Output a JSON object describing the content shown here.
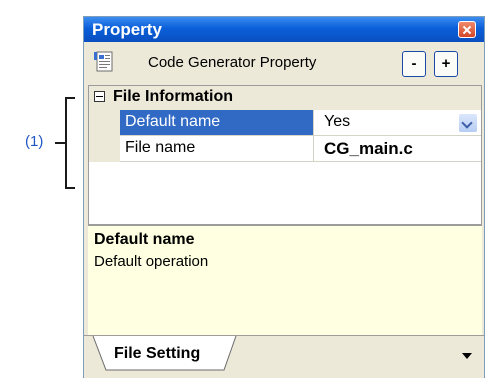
{
  "annotation": {
    "label": "(1)"
  },
  "window": {
    "title": "Property",
    "toolbar": {
      "title": "Code Generator Property",
      "minus_label": "-",
      "plus_label": "+"
    }
  },
  "grid": {
    "category": "File Information",
    "rows": [
      {
        "name": "Default name",
        "value": "Yes",
        "selected": true
      },
      {
        "name": "File name",
        "value": "CG_main.c",
        "selected": false
      }
    ]
  },
  "description": {
    "title": "Default name",
    "body": "Default operation"
  },
  "tabs": [
    {
      "label": "File Setting"
    }
  ],
  "colors": {
    "titlebar": "#0b5fd9",
    "selection": "#316ac5",
    "description_bg": "#ffffe1",
    "annotation": "#1f57c3"
  }
}
